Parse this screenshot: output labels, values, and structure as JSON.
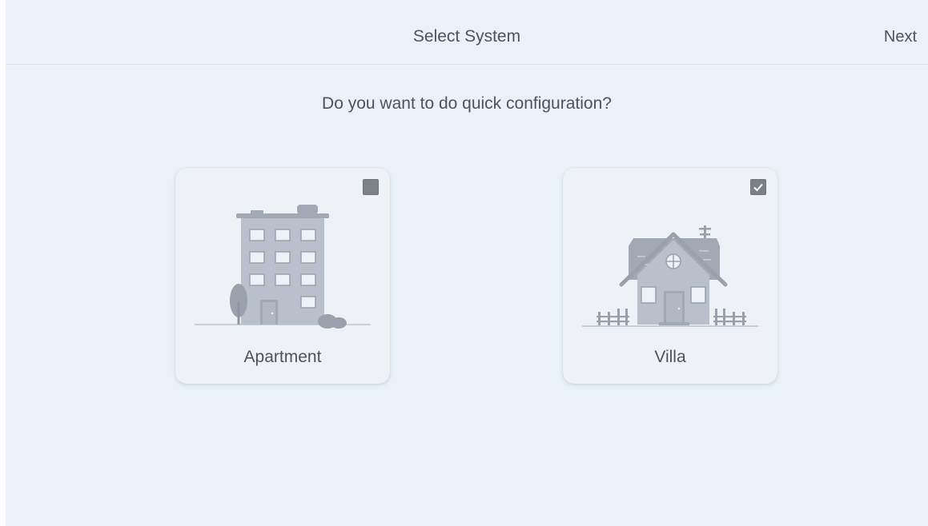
{
  "header": {
    "title": "Select System",
    "next_label": "Next"
  },
  "question": "Do you want to do quick configuration?",
  "options": [
    {
      "label": "Apartment",
      "selected": false,
      "icon": "apartment-building-icon"
    },
    {
      "label": "Villa",
      "selected": true,
      "icon": "villa-house-icon"
    }
  ],
  "colors": {
    "background": "#eaf1f8",
    "card": "#eef2f6",
    "text": "#4e5358",
    "illustration": "#b9c0cb",
    "checkbox": "#7d8288"
  }
}
